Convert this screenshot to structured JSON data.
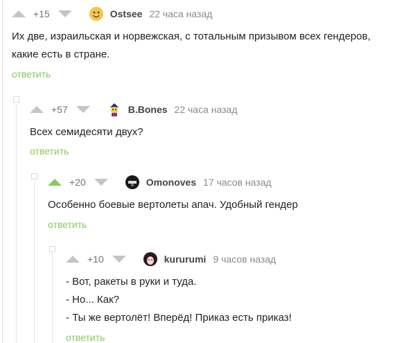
{
  "comments": [
    {
      "rating": "+15",
      "username": "Ostsee",
      "time": "22 часа назад",
      "lines": [
        "Их две, израильская и норвежская, с тотальным призывом всех гендеров,",
        "какие есть в стране."
      ],
      "reply": "ответить",
      "upvoted": false
    },
    {
      "rating": "+57",
      "username": "B.Bones",
      "time": "22 часа назад",
      "lines": [
        "Всех семидесяти двух?"
      ],
      "reply": "ответить",
      "upvoted": false
    },
    {
      "rating": "+20",
      "username": "Omonoves",
      "time": "17 часов назад",
      "lines": [
        "Особенно боевые вертолеты апач. Удобный гендер"
      ],
      "reply": "ответить",
      "upvoted": true
    },
    {
      "rating": "+10",
      "username": "kururumi",
      "time": "9 часов назад",
      "lines": [
        "- Вот, ракеты в руки и туда.",
        "- Но... Как?",
        "- Ты же вертолёт! Вперёд! Приказ есть приказ!"
      ],
      "reply": "ответить",
      "upvoted": false
    }
  ],
  "colors": {
    "accent": "#8ac858",
    "arrow": "#c5c5c5",
    "thread": "#e2e2e2"
  }
}
